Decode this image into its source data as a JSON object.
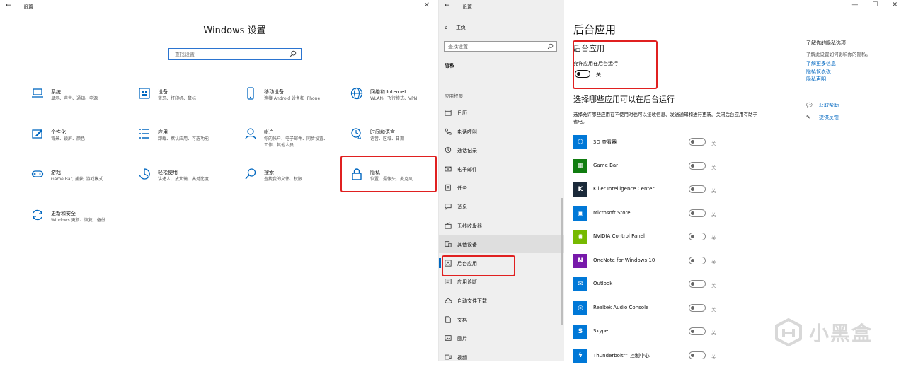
{
  "left": {
    "title": "设置",
    "home_title": "Windows 设置",
    "search_placeholder": "查找设置",
    "categories": [
      {
        "name": "系统",
        "desc1": "显示、声音、通知、电源",
        "desc2": "",
        "icon": "laptop-icon"
      },
      {
        "name": "设备",
        "desc1": "蓝牙、打印机、鼠标",
        "desc2": "",
        "icon": "devices-icon"
      },
      {
        "name": "移动设备",
        "desc1": "连接 Android 设备和 iPhone",
        "desc2": "",
        "icon": "phone-icon"
      },
      {
        "name": "网络和 Internet",
        "desc1": "WLAN、飞行模式、VPN",
        "desc2": "",
        "icon": "globe-icon"
      },
      {
        "name": "个性化",
        "desc1": "背景、锁屏、颜色",
        "desc2": "",
        "icon": "personalization-icon"
      },
      {
        "name": "应用",
        "desc1": "卸载、默认应用、可选功能",
        "desc2": "",
        "icon": "apps-icon"
      },
      {
        "name": "帐户",
        "desc1": "你的帐户、电子邮件、同步设置、",
        "desc2": "工作、其他人员",
        "icon": "person-icon"
      },
      {
        "name": "时间和语言",
        "desc1": "语音、区域、日期",
        "desc2": "",
        "icon": "time-language-icon"
      },
      {
        "name": "游戏",
        "desc1": "Game Bar, 捕获, 游戏模式",
        "desc2": "",
        "icon": "gamepad-icon"
      },
      {
        "name": "轻松使用",
        "desc1": "讲述人、放大镜、高对比度",
        "desc2": "",
        "icon": "ease-of-access-icon"
      },
      {
        "name": "搜索",
        "desc1": "查找我的文件、权限",
        "desc2": "",
        "icon": "search-icon"
      },
      {
        "name": "隐私",
        "desc1": "位置、摄像头、麦克风",
        "desc2": "",
        "icon": "lock-icon"
      },
      {
        "name": "更新和安全",
        "desc1": "Windows 更新、恢复、备份",
        "desc2": "",
        "icon": "update-icon"
      }
    ]
  },
  "nav": {
    "title": "设置",
    "home": "主页",
    "search_placeholder": "查找设置",
    "section": "隐私",
    "perm_header": "应用权限",
    "items": [
      {
        "label": "日历",
        "icon": "calendar-icon"
      },
      {
        "label": "电话呼叫",
        "icon": "call-icon"
      },
      {
        "label": "通话记录",
        "icon": "history-icon"
      },
      {
        "label": "电子邮件",
        "icon": "mail-icon"
      },
      {
        "label": "任务",
        "icon": "tasks-icon"
      },
      {
        "label": "消息",
        "icon": "message-icon"
      },
      {
        "label": "无线收发器",
        "icon": "radio-icon"
      },
      {
        "label": "其他设备",
        "icon": "other-devices-icon"
      },
      {
        "label": "后台应用",
        "icon": "background-apps-icon"
      },
      {
        "label": "应用诊断",
        "icon": "diagnostics-icon"
      },
      {
        "label": "自动文件下载",
        "icon": "cloud-icon"
      },
      {
        "label": "文档",
        "icon": "document-icon"
      },
      {
        "label": "图片",
        "icon": "picture-icon"
      },
      {
        "label": "视频",
        "icon": "video-icon"
      }
    ]
  },
  "content": {
    "page_title": "后台应用",
    "section1_title": "后台应用",
    "allow_label": "允许应用在后台运行",
    "allow_state": "关",
    "section2_title": "选择哪些应用可以在后台运行",
    "section2_desc": "选择允许哪些应用在不使用时也可以接收信息、发送通知和进行更新。关闭后台应用有助于省电。",
    "apps": [
      {
        "name": "3D 查看器",
        "state": "关",
        "color": "#0078d7",
        "glyph": "⬡"
      },
      {
        "name": "Game Bar",
        "state": "关",
        "color": "#107c10",
        "glyph": "▦"
      },
      {
        "name": "Killer Intelligence Center",
        "state": "关",
        "color": "#1b2a3a",
        "glyph": "K"
      },
      {
        "name": "Microsoft Store",
        "state": "关",
        "color": "#0078d7",
        "glyph": "▣"
      },
      {
        "name": "NVIDIA Control Panel",
        "state": "关",
        "color": "#76b900",
        "glyph": "◉"
      },
      {
        "name": "OneNote for Windows 10",
        "state": "关",
        "color": "#7719aa",
        "glyph": "N"
      },
      {
        "name": "Outlook",
        "state": "关",
        "color": "#0078d7",
        "glyph": "✉"
      },
      {
        "name": "Realtek Audio Console",
        "state": "关",
        "color": "#0078d7",
        "glyph": "◎"
      },
      {
        "name": "Skype",
        "state": "关",
        "color": "#0078d7",
        "glyph": "S"
      },
      {
        "name": "Thunderbolt™ 控制中心",
        "state": "关",
        "color": "#0078d7",
        "glyph": "ϟ"
      }
    ]
  },
  "side": {
    "title": "了解你的隐私选项",
    "desc": "了解此设置如何影响你的隐私。",
    "links": [
      "了解更多信息",
      "隐私仪表板",
      "隐私声明"
    ],
    "help": "获取帮助",
    "feedback": "提供反馈"
  },
  "watermark": "小黑盒"
}
